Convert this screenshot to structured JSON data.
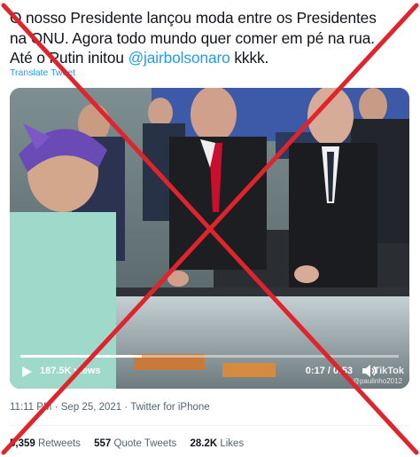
{
  "tweet": {
    "text_line1": "O nosso Presidente lançou moda entre os Presidentes",
    "text_line2": "na ONU. Agora todo mundo quer comer em pé na rua.",
    "text_line3_prefix": "Até o Putin initou ",
    "mention": "@jairbolsonaro",
    "text_line3_suffix": " kkkk.",
    "translate_label": "Translate Tweet"
  },
  "video": {
    "views": "187.5K views",
    "time": "0:17 / 0:53",
    "progress": 0.32,
    "watermark_brand": "TikTok",
    "watermark_user": "@paulinho2012"
  },
  "meta": {
    "time": "11:11 PM",
    "separator": " · ",
    "date": "Sep 25, 2021",
    "source": "Twitter for iPhone"
  },
  "stats": {
    "retweets_count": "5,359",
    "retweets_label": "Retweets",
    "quotes_count": "557",
    "quotes_label": "Quote Tweets",
    "likes_count": "28.2K",
    "likes_label": "Likes"
  },
  "colors": {
    "accent": "#1d9bf0",
    "overlay_x": "#e0242b"
  },
  "icons": [
    "play-icon",
    "volume-icon",
    "tiktok-logo-icon"
  ]
}
